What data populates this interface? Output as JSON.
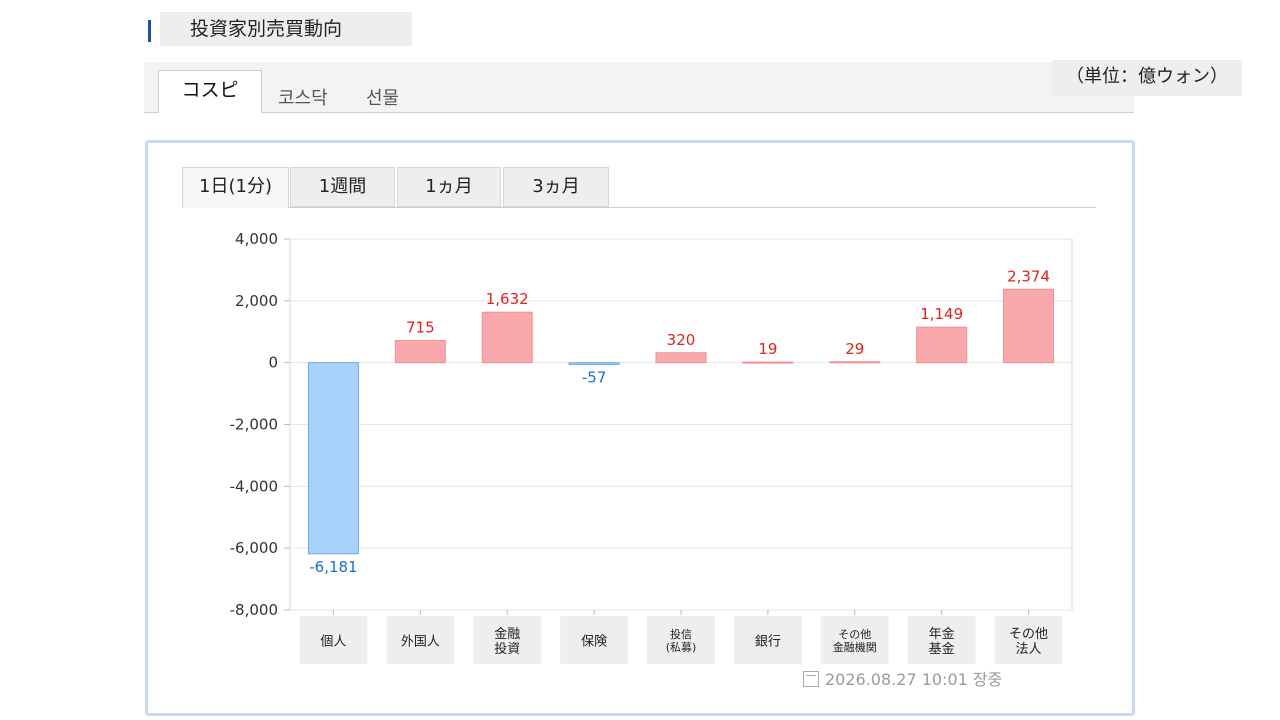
{
  "header": {
    "title": "投資家別売買動向"
  },
  "market_tabs": [
    {
      "label": "コスピ",
      "active": true
    },
    {
      "label": "코스닥",
      "active": false
    },
    {
      "label": "선물",
      "active": false
    }
  ],
  "unit": "（単位：億ウォン）",
  "period_tabs": [
    {
      "label": "1日(1分)",
      "active": true
    },
    {
      "label": "1週間",
      "active": false
    },
    {
      "label": "1ヵ月",
      "active": false
    },
    {
      "label": "3ヵ月",
      "active": false
    }
  ],
  "colors": {
    "positive_fill": "#f9a9ab",
    "positive_text": "#e0241b",
    "negative_fill": "#a9d2fb",
    "negative_text": "#1a6fd4",
    "accent": "#1f4fa0"
  },
  "chart_data": {
    "type": "bar",
    "categories": [
      [
        "個人"
      ],
      [
        "外国人"
      ],
      [
        "金融",
        "投資"
      ],
      [
        "保険"
      ],
      [
        "投信",
        "(私募)"
      ],
      [
        "銀行"
      ],
      [
        "その他",
        "金融機関"
      ],
      [
        "年金",
        "基金"
      ],
      [
        "その他",
        "法人"
      ]
    ],
    "values": [
      -6181,
      715,
      1632,
      -57,
      320,
      19,
      29,
      1149,
      2374
    ],
    "value_labels": [
      "-6,181",
      "715",
      "1,632",
      "-57",
      "320",
      "19",
      "29",
      "1,149",
      "2,374"
    ],
    "yticks": [
      "4,000",
      "2,000",
      "0",
      "-2,000",
      "-4,000",
      "-6,000",
      "-8,000"
    ],
    "ylim": [
      -8000,
      4000
    ],
    "grid": true
  },
  "footer": {
    "timestamp": "2026.08.27 10:01 장중"
  }
}
